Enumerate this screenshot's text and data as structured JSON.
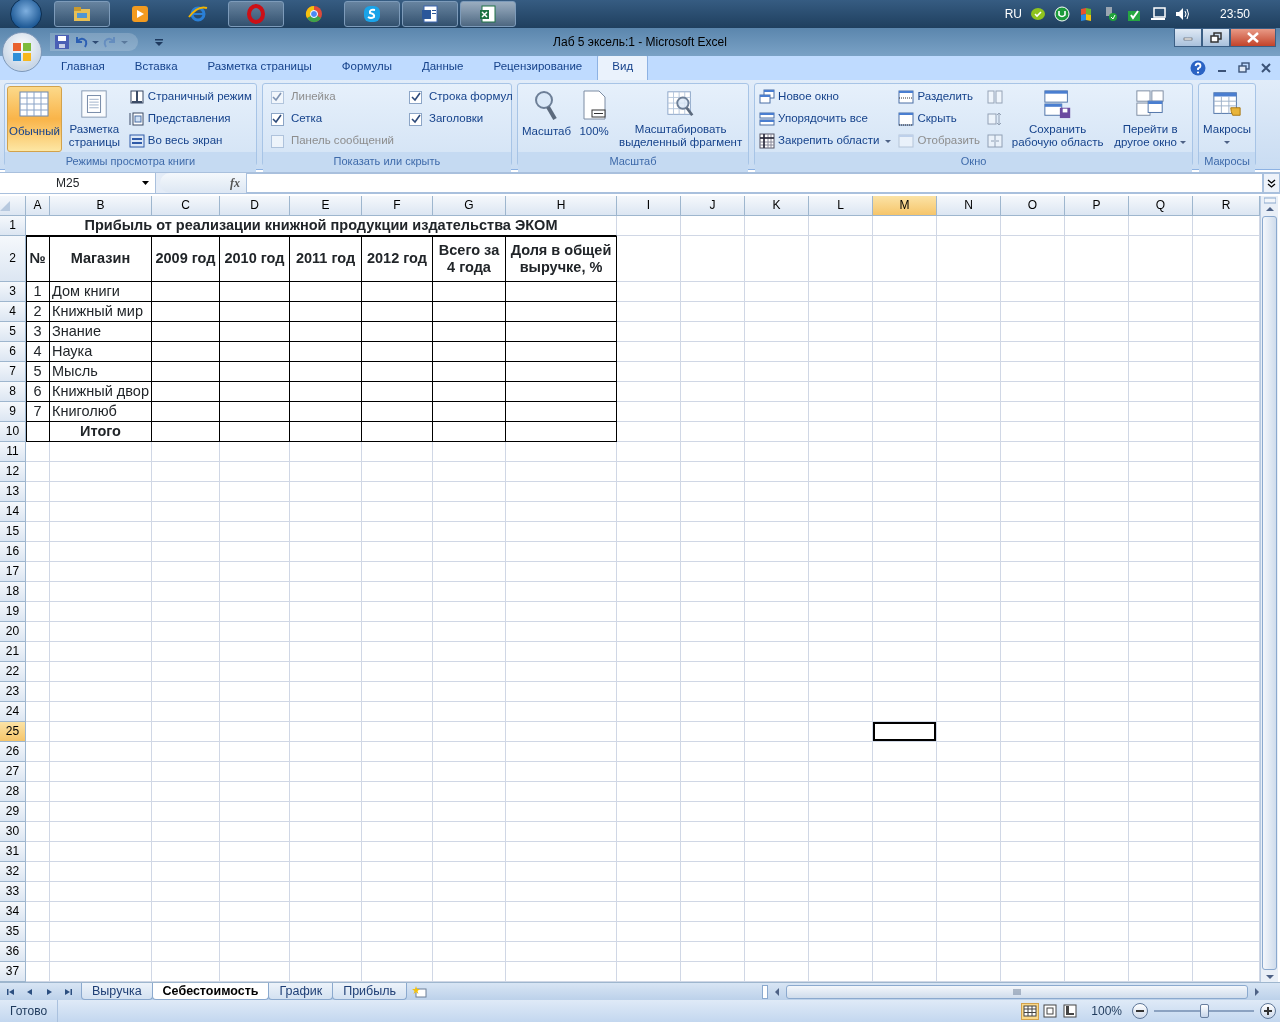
{
  "taskbar": {
    "apps": [
      {
        "running": true,
        "selected": false
      },
      {
        "running": false,
        "selected": false
      },
      {
        "running": false,
        "selected": false
      },
      {
        "running": true,
        "selected": false
      },
      {
        "running": false,
        "selected": false
      },
      {
        "running": true,
        "selected": false
      },
      {
        "running": true,
        "selected": false
      },
      {
        "running": true,
        "selected": true
      }
    ],
    "language": "RU",
    "time": "23:50"
  },
  "window": {
    "title": "Лаб 5 эксель:1 - Microsoft Excel"
  },
  "quick_access": {
    "redo_disabled": true
  },
  "ribbon": {
    "tabs": [
      {
        "label": "Главная",
        "selected": false
      },
      {
        "label": "Вставка",
        "selected": false
      },
      {
        "label": "Разметка страницы",
        "selected": false
      },
      {
        "label": "Формулы",
        "selected": false
      },
      {
        "label": "Данные",
        "selected": false
      },
      {
        "label": "Рецензирование",
        "selected": false
      },
      {
        "label": "Вид",
        "selected": true
      }
    ],
    "groups": [
      {
        "label": "Режимы просмотра книги",
        "items": [
          {
            "kind": "large",
            "label": "Обычный",
            "selected": true
          },
          {
            "kind": "large",
            "label": "Разметка страницы",
            "selected": false
          },
          {
            "kind": "small",
            "label": "Страничный режим",
            "disabled": false
          },
          {
            "kind": "small",
            "label": "Представления",
            "disabled": false
          },
          {
            "kind": "small",
            "label": "Во весь экран",
            "disabled": false
          }
        ]
      },
      {
        "label": "Показать или скрыть",
        "items": [
          {
            "kind": "check",
            "label": "Линейка",
            "checked": true,
            "disabled": true
          },
          {
            "kind": "check",
            "label": "Сетка",
            "checked": true,
            "disabled": false
          },
          {
            "kind": "check",
            "label": "Панель сообщений",
            "checked": false,
            "disabled": true
          },
          {
            "kind": "check",
            "label": "Строка формул",
            "checked": true,
            "disabled": false
          },
          {
            "kind": "check",
            "label": "Заголовки",
            "checked": true,
            "disabled": false
          }
        ]
      },
      {
        "label": "Масштаб",
        "items": [
          {
            "kind": "large",
            "label": "Масштаб",
            "selected": false
          },
          {
            "kind": "large",
            "label": "100%",
            "selected": false
          },
          {
            "kind": "large",
            "label": "Масштабировать выделенный фрагмент",
            "selected": false
          }
        ]
      },
      {
        "label": "Окно",
        "items": [
          {
            "kind": "small",
            "label": "Новое окно",
            "disabled": false
          },
          {
            "kind": "small",
            "label": "Упорядочить все",
            "disabled": false
          },
          {
            "kind": "small",
            "label": "Закрепить области",
            "disabled": false,
            "dropdown": true
          },
          {
            "kind": "small",
            "label": "Разделить",
            "disabled": false
          },
          {
            "kind": "small",
            "label": "Скрыть",
            "disabled": false
          },
          {
            "kind": "small",
            "label": "Отобразить",
            "disabled": true
          },
          {
            "kind": "small",
            "disabled": true
          },
          {
            "kind": "small",
            "disabled": true
          },
          {
            "kind": "small",
            "disabled": true
          },
          {
            "kind": "large",
            "label": "Сохранить рабочую область",
            "selected": false
          },
          {
            "kind": "large",
            "label": "Перейти в другое окно",
            "selected": false,
            "dropdown": true
          }
        ]
      },
      {
        "label": "Макросы",
        "items": [
          {
            "kind": "large",
            "label": "Макросы",
            "selected": false,
            "dropdown": true
          }
        ]
      }
    ]
  },
  "formula_bar": {
    "name_box": "M25",
    "function_label": "fx"
  },
  "sheet": {
    "columns": [
      {
        "label": "A",
        "selected": false
      },
      {
        "label": "B",
        "selected": false
      },
      {
        "label": "C",
        "selected": false
      },
      {
        "label": "D",
        "selected": false
      },
      {
        "label": "E",
        "selected": false
      },
      {
        "label": "F",
        "selected": false
      },
      {
        "label": "G",
        "selected": false
      },
      {
        "label": "H",
        "selected": false
      },
      {
        "label": "I",
        "selected": false
      },
      {
        "label": "J",
        "selected": false
      },
      {
        "label": "K",
        "selected": false
      },
      {
        "label": "L",
        "selected": false
      },
      {
        "label": "M",
        "selected": true
      },
      {
        "label": "N",
        "selected": false
      },
      {
        "label": "O",
        "selected": false
      },
      {
        "label": "P",
        "selected": false
      },
      {
        "label": "Q",
        "selected": false
      },
      {
        "label": "R",
        "selected": false
      }
    ],
    "rows": [
      {
        "label": "1",
        "selected": false
      },
      {
        "label": "2",
        "selected": false
      },
      {
        "label": "3",
        "selected": false
      },
      {
        "label": "4",
        "selected": false
      },
      {
        "label": "5",
        "selected": false
      },
      {
        "label": "6",
        "selected": false
      },
      {
        "label": "7",
        "selected": false
      },
      {
        "label": "8",
        "selected": false
      },
      {
        "label": "9",
        "selected": false
      },
      {
        "label": "10",
        "selected": false
      },
      {
        "label": "11",
        "selected": false
      },
      {
        "label": "12",
        "selected": false
      },
      {
        "label": "13",
        "selected": false
      },
      {
        "label": "14",
        "selected": false
      },
      {
        "label": "15",
        "selected": false
      },
      {
        "label": "16",
        "selected": false
      },
      {
        "label": "17",
        "selected": false
      },
      {
        "label": "18",
        "selected": false
      },
      {
        "label": "19",
        "selected": false
      },
      {
        "label": "20",
        "selected": false
      },
      {
        "label": "21",
        "selected": false
      },
      {
        "label": "22",
        "selected": false
      },
      {
        "label": "23",
        "selected": false
      },
      {
        "label": "24",
        "selected": false
      },
      {
        "label": "25",
        "selected": true
      },
      {
        "label": "26",
        "selected": false
      },
      {
        "label": "27",
        "selected": false
      },
      {
        "label": "28",
        "selected": false
      },
      {
        "label": "29",
        "selected": false
      },
      {
        "label": "30",
        "selected": false
      },
      {
        "label": "31",
        "selected": false
      },
      {
        "label": "32",
        "selected": false
      },
      {
        "label": "33",
        "selected": false
      },
      {
        "label": "34",
        "selected": false
      },
      {
        "label": "35",
        "selected": false
      },
      {
        "label": "36",
        "selected": false
      },
      {
        "label": "37",
        "selected": false
      }
    ],
    "table": {
      "title": "Прибыль от реализации книжной продукции издательства ЭКОМ",
      "headers": [
        "№",
        "Магазин",
        "2009 год",
        "2010 год",
        "2011 год",
        "2012 год",
        "Всего за 4 года",
        "Доля в общей выручке, %"
      ],
      "rows": [
        {
          "number": "1",
          "store": "Дом книги"
        },
        {
          "number": "2",
          "store": "Книжный мир"
        },
        {
          "number": "3",
          "store": "Знание"
        },
        {
          "number": "4",
          "store": "Наука"
        },
        {
          "number": "5",
          "store": "Мысль"
        },
        {
          "number": "6",
          "store": "Книжный двор"
        },
        {
          "number": "7",
          "store": "Книголюб"
        }
      ],
      "total_label": "Итого"
    }
  },
  "sheet_tabs": [
    {
      "label": "Выручка",
      "selected": false
    },
    {
      "label": "Себестоимость",
      "selected": true
    },
    {
      "label": "График",
      "selected": false
    },
    {
      "label": "Прибыль",
      "selected": false
    }
  ],
  "status_bar": {
    "text": "Готово",
    "views": [
      {
        "selected": true
      },
      {
        "selected": false
      },
      {
        "selected": false
      }
    ],
    "zoom": "100%",
    "zoom_slider": {
      "level": 0.5
    }
  }
}
